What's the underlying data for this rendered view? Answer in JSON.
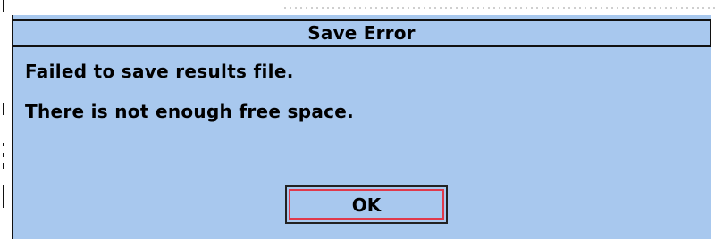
{
  "dialog": {
    "title": "Save Error",
    "message_line_1": "Failed to save results file.",
    "message_line_2": "There is not enough free space.",
    "ok_label": "OK"
  },
  "colors": {
    "dialog_background": "#a8c8ee",
    "border": "#111111",
    "ok_focus_ring": "#e0394a"
  }
}
